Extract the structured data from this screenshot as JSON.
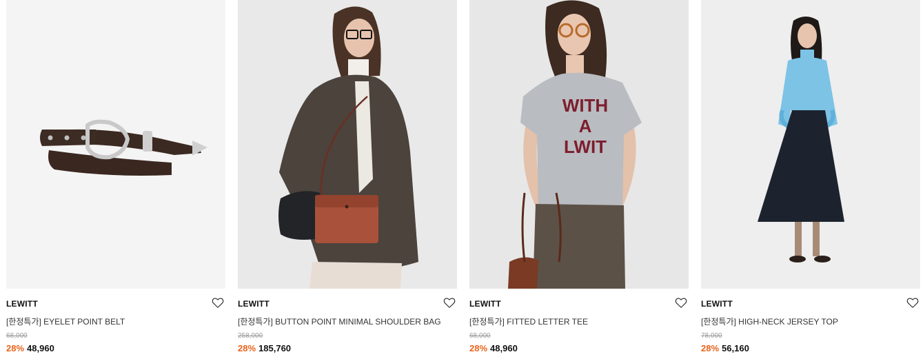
{
  "products": [
    {
      "brand": "LEWITT",
      "name": "[한정특가] EYELET POINT BELT",
      "original_price": "68,000",
      "discount": "28%",
      "price": "48,960",
      "image": "belt-product-photo",
      "bg": "#f4f4f4"
    },
    {
      "brand": "LEWITT",
      "name": "[한정특가] BUTTON POINT MINIMAL SHOULDER BAG",
      "original_price": "258,000",
      "discount": "28%",
      "price": "185,760",
      "image": "model-with-shoulder-bag-photo",
      "bg": "#e9e9e9"
    },
    {
      "brand": "LEWITT",
      "name": "[한정특가] FITTED LETTER TEE",
      "original_price": "68,000",
      "discount": "28%",
      "price": "48,960",
      "image": "model-in-letter-tee-photo",
      "bg": "#e7e7e7",
      "tee_print": [
        "WITH",
        "A",
        "LWIT"
      ]
    },
    {
      "brand": "LEWITT",
      "name": "[한정특가] HIGH-NECK JERSEY TOP",
      "original_price": "78,000",
      "discount": "28%",
      "price": "56,160",
      "image": "model-in-jersey-top-photo",
      "bg": "#eeeeee"
    }
  ],
  "colors": {
    "discount": "#e8631b",
    "original_price": "#9a9a9a",
    "text": "#111111"
  },
  "icons": {
    "wishlist": "heart-outline-icon"
  }
}
